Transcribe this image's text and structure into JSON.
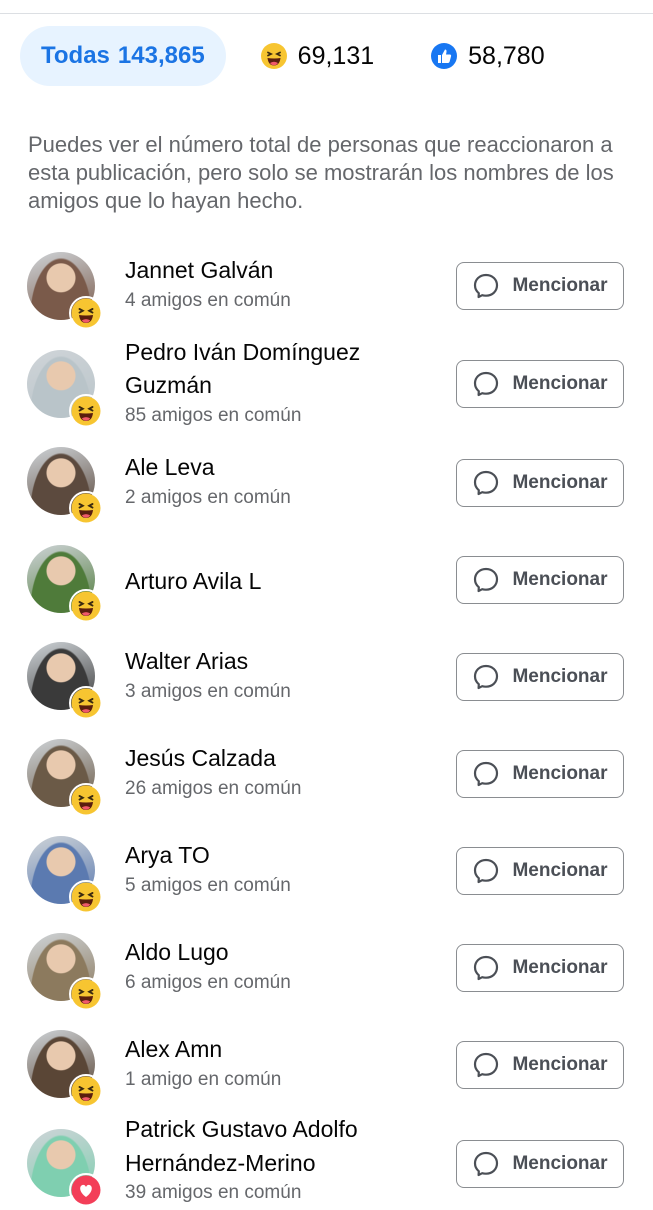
{
  "tabs": {
    "all_label": "Todas",
    "all_count": "143,865",
    "haha_count": "69,131",
    "like_count": "58,780"
  },
  "notice": "Puedes ver el número total de personas que reaccionaron a esta publicación, pero solo se mostrarán los nombres de los amigos que lo hayan hecho.",
  "mention_label": "Mencionar",
  "people": [
    {
      "name": "Jannet Galván",
      "mutual": "4 amigos en común",
      "reaction": "haha",
      "avatar_color": "#7a5a4a"
    },
    {
      "name": "Pedro Iván Domínguez Guzmán",
      "mutual": "85 amigos en común",
      "reaction": "haha",
      "avatar_color": "#b9c4c9"
    },
    {
      "name": "Ale Leva",
      "mutual": "2 amigos en común",
      "reaction": "haha",
      "avatar_color": "#5c4a3e"
    },
    {
      "name": "Arturo Avila L",
      "mutual": "",
      "reaction": "haha",
      "avatar_color": "#4f7b3a"
    },
    {
      "name": "Walter Arias",
      "mutual": "3 amigos en común",
      "reaction": "haha",
      "avatar_color": "#3a3a3a"
    },
    {
      "name": "Jesús Calzada",
      "mutual": "26 amigos en común",
      "reaction": "haha",
      "avatar_color": "#6b5a47"
    },
    {
      "name": "Arya TO",
      "mutual": "5 amigos en común",
      "reaction": "haha",
      "avatar_color": "#5b7ab0"
    },
    {
      "name": "Aldo Lugo",
      "mutual": "6 amigos en común",
      "reaction": "haha",
      "avatar_color": "#8c7a5e"
    },
    {
      "name": "Alex Amn",
      "mutual": "1 amigo en común",
      "reaction": "haha",
      "avatar_color": "#5a4636"
    },
    {
      "name": "Patrick Gustavo Adolfo Hernández-Merino",
      "mutual": "39 amigos en común",
      "reaction": "love",
      "avatar_color": "#7fcfb0"
    }
  ],
  "colors": {
    "accent": "#1b74e4",
    "tab_bg": "#e7f3ff",
    "secondary_text": "#65676b",
    "haha_yellow": "#f7c531",
    "love_red": "#f33e58",
    "like_blue": "#1877f2"
  }
}
